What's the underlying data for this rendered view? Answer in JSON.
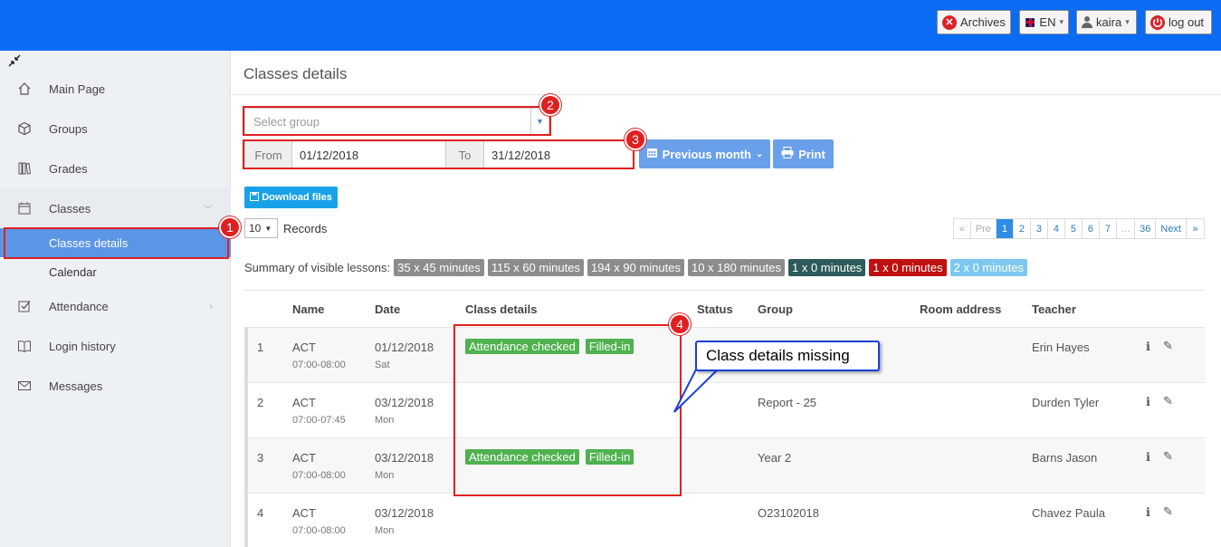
{
  "topbar": {
    "archives": "Archives",
    "lang": "EN",
    "user": "kaira",
    "logout": "log out",
    "color": "#0a6cf5"
  },
  "sidebar": {
    "items": [
      {
        "label": "Main Page",
        "icon": "home-icon"
      },
      {
        "label": "Groups",
        "icon": "cube-icon"
      },
      {
        "label": "Grades",
        "icon": "books-icon"
      },
      {
        "label": "Classes",
        "icon": "calendar-icon"
      },
      {
        "label": "Attendance",
        "icon": "checkbox-icon"
      },
      {
        "label": "Login history",
        "icon": "book-icon"
      },
      {
        "label": "Messages",
        "icon": "envelope-icon"
      }
    ],
    "sub": [
      {
        "label": "Classes details"
      },
      {
        "label": "Calendar"
      }
    ]
  },
  "main": {
    "title": "Classes details",
    "select_placeholder": "Select group",
    "from_label": "From",
    "from_value": "01/12/2018",
    "to_label": "To",
    "to_value": "31/12/2018",
    "prev_month": "Previous month",
    "print": "Print",
    "download": "Download files",
    "records_count": "10",
    "records_label": "Records",
    "pager": [
      "«",
      "Pre",
      "1",
      "2",
      "3",
      "4",
      "5",
      "6",
      "7",
      "...",
      "36",
      "Next",
      "»"
    ],
    "summary_label": "Summary of visible lessons:",
    "summary_badges": [
      {
        "text": "35 x 45 minutes",
        "color": "#8c8c8c"
      },
      {
        "text": "115 x 60 minutes",
        "color": "#8c8c8c"
      },
      {
        "text": "194 x 90 minutes",
        "color": "#8c8c8c"
      },
      {
        "text": "10 x 180 minutes",
        "color": "#8c8c8c"
      },
      {
        "text": "1 x 0 minutes",
        "color": "#2d5a5a"
      },
      {
        "text": "1 x 0 minutes",
        "color": "#c01010"
      },
      {
        "text": "2 x 0 minutes",
        "color": "#7cc8f0"
      }
    ]
  },
  "table": {
    "headers": [
      "Name",
      "Date",
      "Class details",
      "Status",
      "Group",
      "Room address",
      "Teacher"
    ],
    "rows": [
      {
        "n": "1",
        "name": "ACT",
        "time": "07:00-08:00",
        "date": "01/12/2018",
        "day": "Sat",
        "att": "Attendance checked",
        "fill": "Filled-in",
        "group": "",
        "teacher": "Erin Hayes"
      },
      {
        "n": "2",
        "name": "ACT",
        "time": "07:00-07:45",
        "date": "03/12/2018",
        "day": "Mon",
        "att": "",
        "fill": "",
        "group": "Report - 25",
        "teacher": "Durden Tyler"
      },
      {
        "n": "3",
        "name": "ACT",
        "time": "07:00-08:00",
        "date": "03/12/2018",
        "day": "Mon",
        "att": "Attendance checked",
        "fill": "Filled-in",
        "group": "Year 2",
        "teacher": "Barns Jason"
      },
      {
        "n": "4",
        "name": "ACT",
        "time": "07:00-08:00",
        "date": "03/12/2018",
        "day": "Mon",
        "att": "",
        "fill": "",
        "group": "O23102018",
        "teacher": "Chavez Paula"
      }
    ]
  },
  "annotations": {
    "markers": [
      "1",
      "2",
      "3",
      "4"
    ],
    "callout": "Class details missing"
  }
}
